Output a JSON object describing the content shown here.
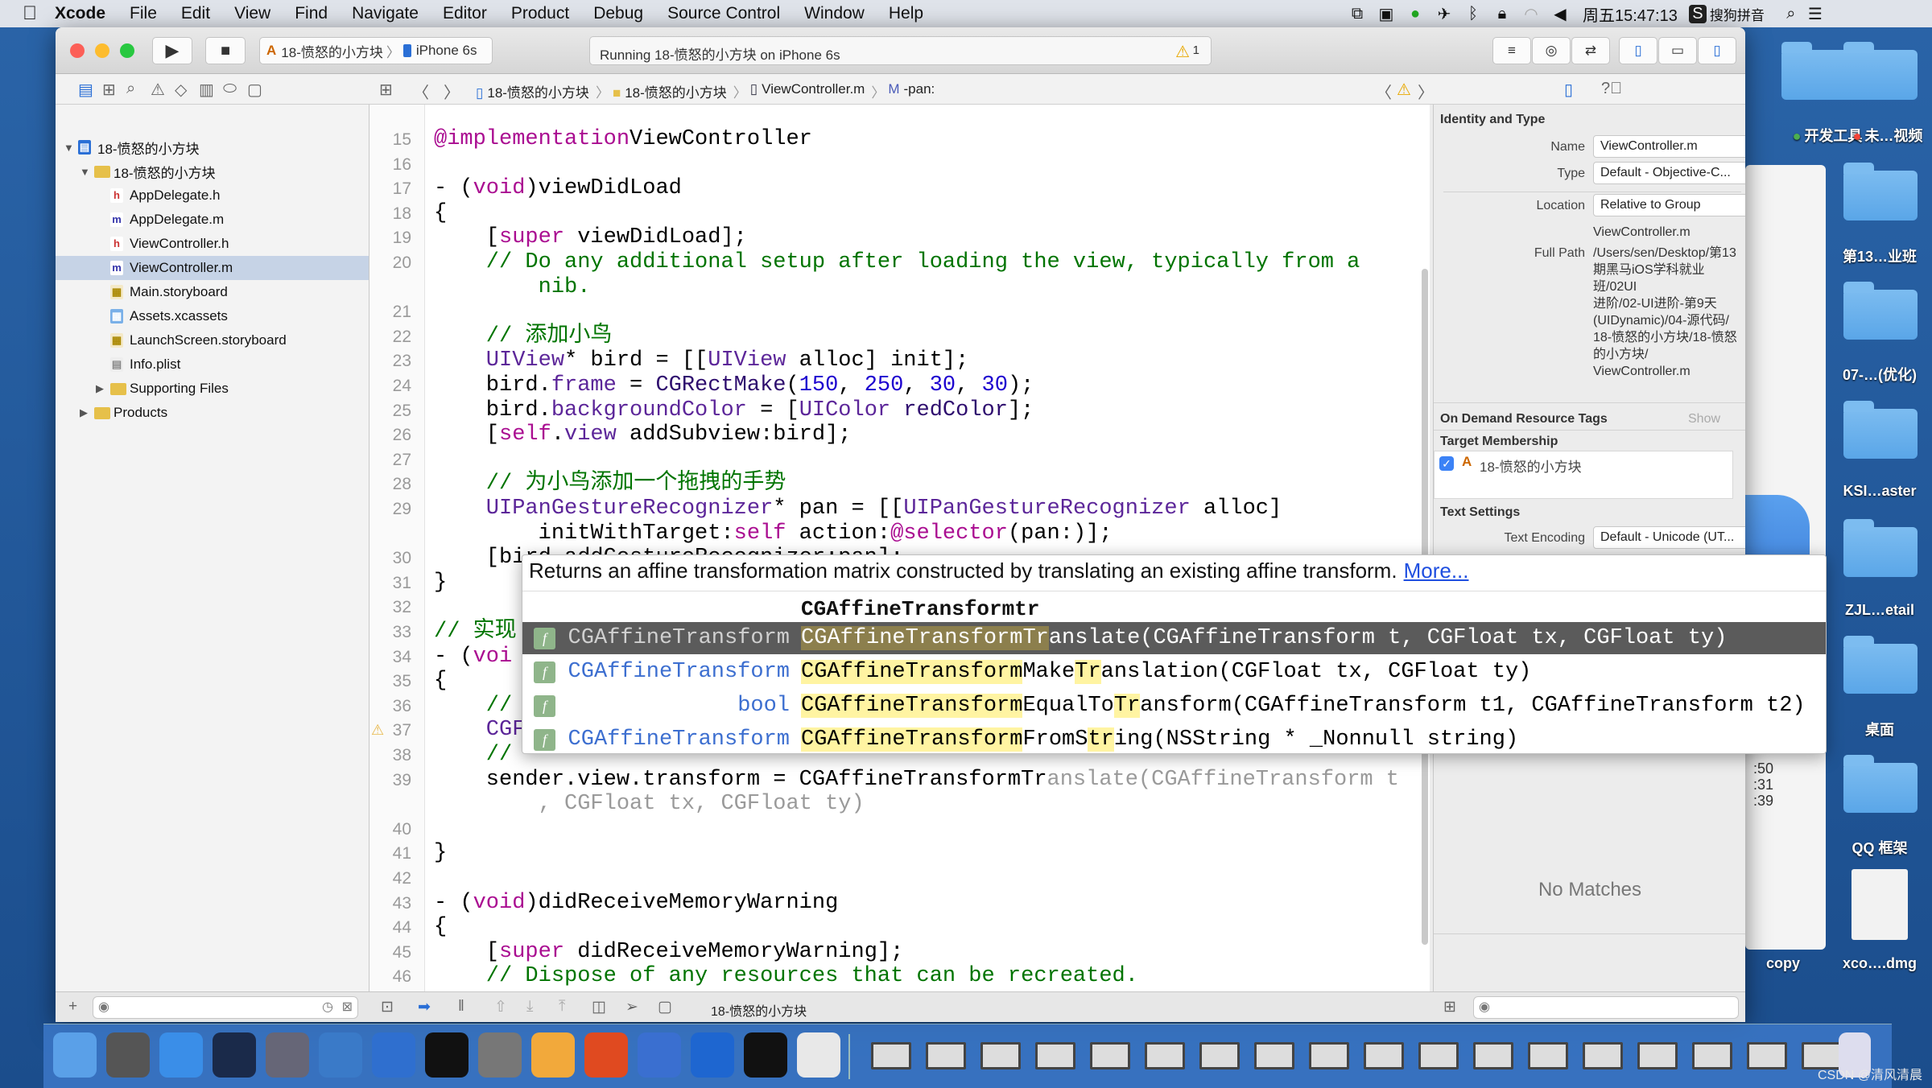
{
  "menubar": {
    "app": "Xcode",
    "items": [
      "File",
      "Edit",
      "View",
      "Find",
      "Navigate",
      "Editor",
      "Product",
      "Debug",
      "Source Control",
      "Window",
      "Help"
    ],
    "clock": "周五15:47:13",
    "input_method": "搜狗拼音"
  },
  "toolbar": {
    "scheme": "18-愤怒的小方块",
    "device": "iPhone 6s",
    "activity": "Running 18-愤怒的小方块 on iPhone 6s",
    "warning_count": "1"
  },
  "jumpbar": {
    "items": [
      "18-愤怒的小方块",
      "18-愤怒的小方块",
      "ViewController.m",
      "-pan:"
    ]
  },
  "navigator": {
    "items": [
      {
        "label": "18-愤怒的小方块",
        "level": 0,
        "icon": "project",
        "disclosure": "open"
      },
      {
        "label": "18-愤怒的小方块",
        "level": 1,
        "icon": "folder",
        "disclosure": "open"
      },
      {
        "label": "AppDelegate.h",
        "level": 2,
        "icon": "h"
      },
      {
        "label": "AppDelegate.m",
        "level": 2,
        "icon": "m"
      },
      {
        "label": "ViewController.h",
        "level": 2,
        "icon": "h"
      },
      {
        "label": "ViewController.m",
        "level": 2,
        "icon": "m",
        "selected": true
      },
      {
        "label": "Main.storyboard",
        "level": 2,
        "icon": "storyboard"
      },
      {
        "label": "Assets.xcassets",
        "level": 2,
        "icon": "assets"
      },
      {
        "label": "LaunchScreen.storyboard",
        "level": 2,
        "icon": "storyboard"
      },
      {
        "label": "Info.plist",
        "level": 2,
        "icon": "plist"
      },
      {
        "label": "Supporting Files",
        "level": 2,
        "icon": "folder",
        "disclosure": "closed"
      },
      {
        "label": "Products",
        "level": 1,
        "icon": "folder",
        "disclosure": "closed"
      }
    ]
  },
  "code": {
    "lines": [
      {
        "n": "15",
        "seg": [
          [
            "kw",
            "@implementation"
          ],
          [
            "",
            "ViewController"
          ]
        ]
      },
      {
        "n": "16",
        "seg": []
      },
      {
        "n": "17",
        "seg": [
          [
            "",
            "- ("
          ],
          [
            "kw",
            "void"
          ],
          [
            "",
            ")viewDidLoad"
          ]
        ]
      },
      {
        "n": "18",
        "seg": [
          [
            "",
            "{"
          ]
        ]
      },
      {
        "n": "19",
        "seg": [
          [
            "",
            "    ["
          ],
          [
            "kw",
            "super"
          ],
          [
            "",
            " viewDidLoad];"
          ]
        ]
      },
      {
        "n": "20",
        "seg": [
          [
            "cm",
            "    // Do any additional setup after loading the view, typically from a"
          ]
        ]
      },
      {
        "n": "",
        "seg": [
          [
            "cm",
            "        nib."
          ]
        ]
      },
      {
        "n": "21",
        "seg": []
      },
      {
        "n": "22",
        "seg": [
          [
            "cm",
            "    // 添加小鸟"
          ]
        ]
      },
      {
        "n": "23",
        "seg": [
          [
            "cls",
            "    UIView"
          ],
          [
            "",
            "* bird = [["
          ],
          [
            "cls",
            "UIView"
          ],
          [
            "",
            " alloc] init];"
          ]
        ]
      },
      {
        "n": "24",
        "seg": [
          [
            "",
            "    bird."
          ],
          [
            "prop",
            "frame"
          ],
          [
            "",
            " = "
          ],
          [
            "mth",
            "CGRectMake"
          ],
          [
            "",
            "("
          ],
          [
            "num",
            "150"
          ],
          [
            "",
            ", "
          ],
          [
            "num",
            "250"
          ],
          [
            "",
            ", "
          ],
          [
            "num",
            "30"
          ],
          [
            "",
            ", "
          ],
          [
            "num",
            "30"
          ],
          [
            "",
            ");"
          ]
        ]
      },
      {
        "n": "25",
        "seg": [
          [
            "",
            "    bird."
          ],
          [
            "prop",
            "backgroundColor"
          ],
          [
            "",
            " = ["
          ],
          [
            "cls",
            "UIColor"
          ],
          [
            "mth",
            " redColor"
          ],
          [
            "",
            "];"
          ]
        ]
      },
      {
        "n": "26",
        "seg": [
          [
            "",
            "    ["
          ],
          [
            "kw",
            "self"
          ],
          [
            "",
            "."
          ],
          [
            "prop",
            "view"
          ],
          [
            "",
            " addSubview:bird];"
          ]
        ]
      },
      {
        "n": "27",
        "seg": []
      },
      {
        "n": "28",
        "seg": [
          [
            "cm",
            "    // 为小鸟添加一个拖拽的手势"
          ]
        ]
      },
      {
        "n": "29",
        "seg": [
          [
            "cls",
            "    UIPanGestureRecognizer"
          ],
          [
            "",
            "* pan = [["
          ],
          [
            "cls",
            "UIPanGestureRecognizer"
          ],
          [
            "",
            " alloc]"
          ]
        ]
      },
      {
        "n": "",
        "seg": [
          [
            "",
            "        initWithTarget:"
          ],
          [
            "kw",
            "self"
          ],
          [
            "",
            " action:"
          ],
          [
            "kw",
            "@selector"
          ],
          [
            "",
            "(pan:)];"
          ]
        ]
      },
      {
        "n": "30",
        "seg": [
          [
            "",
            "    [bird addGestureRecognizer:pan];"
          ]
        ]
      },
      {
        "n": "31",
        "seg": [
          [
            "",
            "}"
          ]
        ]
      },
      {
        "n": "32",
        "seg": []
      },
      {
        "n": "33",
        "seg": [
          [
            "cm",
            "// 实现"
          ]
        ]
      },
      {
        "n": "34",
        "seg": [
          [
            "",
            "- ("
          ],
          [
            "kw",
            "voi"
          ]
        ]
      },
      {
        "n": "35",
        "seg": [
          [
            "",
            "{"
          ]
        ]
      },
      {
        "n": "36",
        "seg": [
          [
            "cm",
            "    //"
          ]
        ]
      },
      {
        "n": "37",
        "seg": [
          [
            "cls",
            "    CGF"
          ]
        ],
        "warning": true
      },
      {
        "n": "38",
        "seg": [
          [
            "cm",
            "    //"
          ]
        ]
      },
      {
        "n": "39",
        "seg": [
          [
            "",
            "    sender.view.transform = CGAffineTransformTr"
          ],
          [
            "ghost",
            "anslate(CGAffineTransform t"
          ]
        ]
      },
      {
        "n": "",
        "seg": [
          [
            "ghost",
            "        , CGFloat tx, CGFloat ty)"
          ]
        ]
      },
      {
        "n": "40",
        "seg": []
      },
      {
        "n": "41",
        "seg": [
          [
            "",
            "}"
          ]
        ]
      },
      {
        "n": "42",
        "seg": []
      },
      {
        "n": "43",
        "seg": [
          [
            "",
            "- ("
          ],
          [
            "kw",
            "void"
          ],
          [
            "",
            ")didReceiveMemoryWarning"
          ]
        ]
      },
      {
        "n": "44",
        "seg": [
          [
            "",
            "{"
          ]
        ]
      },
      {
        "n": "45",
        "seg": [
          [
            "",
            "    ["
          ],
          [
            "kw",
            "super"
          ],
          [
            "",
            " didReceiveMemoryWarning];"
          ]
        ]
      },
      {
        "n": "46",
        "seg": [
          [
            "cm",
            "    // Dispose of any resources that can be recreated."
          ]
        ]
      }
    ]
  },
  "completion": {
    "doc": "Returns an affine transformation matrix constructed by translating an existing affine transform.",
    "more": "More...",
    "typed": "CGAffineTransformtr",
    "items": [
      {
        "ret": "CGAffineTransform",
        "seg": [
          [
            "hl",
            "CGAffineTransformTr"
          ],
          [
            "",
            "anslate(CGAffineTransform t, CGFloat tx, CGFloat ty)"
          ]
        ],
        "selected": true
      },
      {
        "ret": "CGAffineTransform",
        "seg": [
          [
            "hl",
            "CGAffineTransform"
          ],
          [
            "",
            "Make"
          ],
          [
            "hl",
            "Tr"
          ],
          [
            "",
            "anslation(CGFloat tx, CGFloat ty)"
          ]
        ]
      },
      {
        "ret": "bool",
        "seg": [
          [
            "hl",
            "CGAffineTransform"
          ],
          [
            "",
            "EqualTo"
          ],
          [
            "hl",
            "Tr"
          ],
          [
            "",
            "ansform(CGAffineTransform t1, CGAffineTransform t2)"
          ]
        ]
      },
      {
        "ret": "CGAffineTransform",
        "seg": [
          [
            "hl",
            "CGAffineTransform"
          ],
          [
            "",
            "FromS"
          ],
          [
            "hl",
            "tr"
          ],
          [
            "",
            "ing(NSString * _Nonnull string)"
          ]
        ]
      }
    ]
  },
  "inspector": {
    "identity_title": "Identity and Type",
    "name_label": "Name",
    "name_value": "ViewController.m",
    "type_label": "Type",
    "type_value": "Default - Objective-C...",
    "location_label": "Location",
    "location_value": "Relative to Group",
    "location_file": "ViewController.m",
    "fullpath_label": "Full Path",
    "fullpath_lines": [
      "/Users/sen/Desktop/第13",
      "期黑马iOS学科就业班/02UI",
      "进阶/02-UI进阶-第9天",
      "(UIDynamic)/04-源代码/",
      "18-愤怒的小方块/18-愤怒",
      "的小方块/",
      "ViewController.m"
    ],
    "odr_title": "On Demand Resource Tags",
    "odr_show": "Show",
    "target_title": "Target Membership",
    "target_name": "18-愤怒的小方块",
    "target_checked": true,
    "text_title": "Text Settings",
    "encoding_label": "Text Encoding",
    "encoding_value": "Default - Unicode (UT...",
    "library_empty": "No Matches"
  },
  "debugbar": {
    "target": "18-愤怒的小方块"
  },
  "desktop": {
    "icons": [
      {
        "label": "开发工具",
        "tag": "#4caf50"
      },
      {
        "label": "未…视频",
        "tag": "#f44336"
      },
      {
        "label": "第13…业班"
      },
      {
        "label": "07-…(优化)"
      },
      {
        "label": "KSI…aster"
      },
      {
        "label": "ZJL…etail"
      },
      {
        "label": "桌面"
      },
      {
        "label": "QQ 框架"
      },
      {
        "label": "copy"
      },
      {
        "label": "xco….dmg"
      }
    ],
    "behind_text": [
      ":50",
      ":31",
      ":39"
    ]
  },
  "dock": {
    "apps": [
      "finder",
      "launchpad",
      "safari",
      "mouse",
      "photo-slideshow",
      "xcode",
      "xcode-beta",
      "terminal",
      "system-preferences",
      "sketch",
      "paw",
      "quicktime",
      "teamviewer",
      "activity-terminal",
      "chrome"
    ],
    "window_thumbnails": 18,
    "trash": "trash"
  },
  "watermark": "CSDN @清风清晨"
}
